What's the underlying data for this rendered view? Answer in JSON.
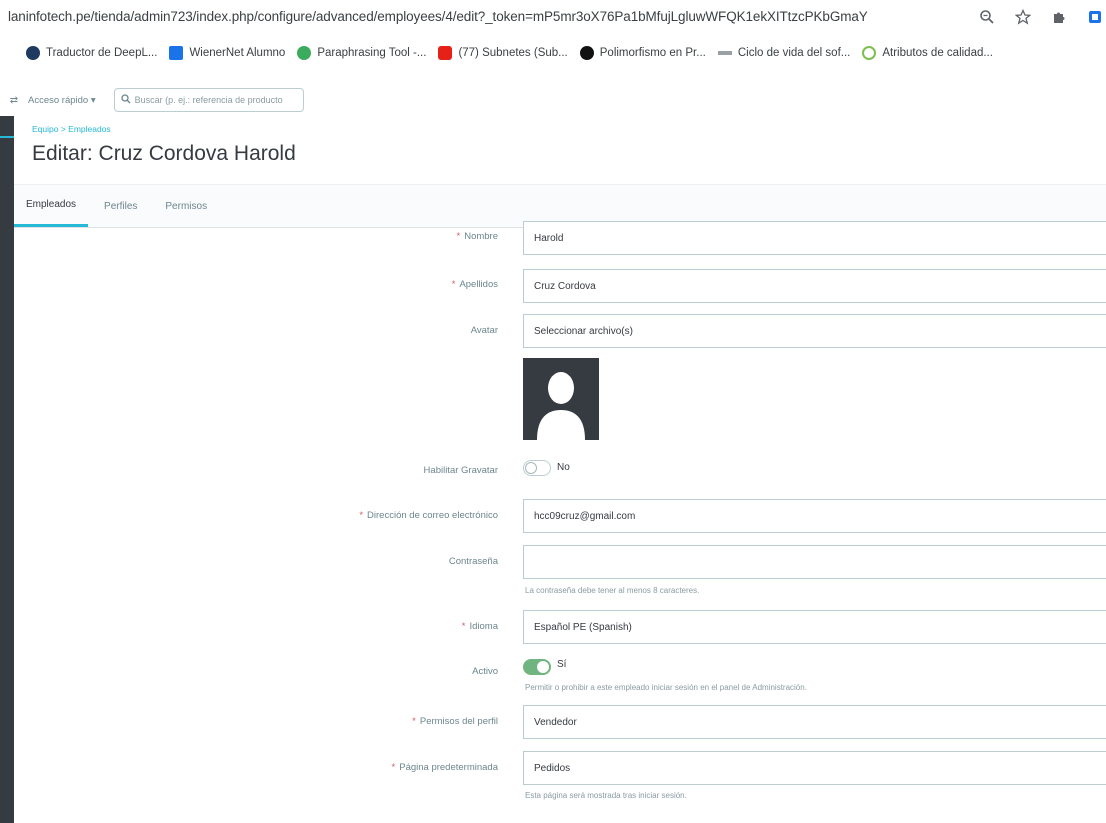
{
  "browser": {
    "url": "laninfotech.pe/tienda/admin723/index.php/configure/advanced/employees/4/edit?_token=mP5mr3oX76Pa1bMfujLgluwWFQK1ekXITtzcPKbGmaY",
    "icons": [
      "zoom-icon",
      "star-icon",
      "extensions-icon",
      "sidebar-icon"
    ]
  },
  "bookmarks": {
    "lead": "",
    "items": [
      {
        "label": "Traductor de DeepL...",
        "color": "#1e3a5f"
      },
      {
        "label": "WienerNet Alumno",
        "color": "#1a73e8"
      },
      {
        "label": "Paraphrasing Tool -...",
        "color": "#3bab5e"
      },
      {
        "label": "(77) Subnetes (Sub...",
        "color": "#e62117"
      },
      {
        "label": "Polimorfismo en Pr...",
        "color": "#111111"
      },
      {
        "label": "Ciclo de vida del sof...",
        "color": "#9aa0a6"
      },
      {
        "label": "Atributos de calidad...",
        "color": "#7cbf4e"
      }
    ]
  },
  "topbar": {
    "quick_access": "Acceso rápido ▾",
    "search_placeholder": "Buscar (p. ej.: referencia de producto"
  },
  "header": {
    "breadcrumb": "Equipo  >  Empleados",
    "title": "Editar: Cruz Cordova Harold"
  },
  "tabs": [
    {
      "label": "Empleados",
      "active": true
    },
    {
      "label": "Perfiles",
      "active": false
    },
    {
      "label": "Permisos",
      "active": false
    }
  ],
  "form": {
    "nombre": {
      "label": "Nombre",
      "value": "Harold"
    },
    "apellidos": {
      "label": "Apellidos",
      "value": "Cruz Cordova"
    },
    "avatar": {
      "label": "Avatar",
      "value": "Seleccionar archivo(s)"
    },
    "gravatar": {
      "label": "Habilitar Gravatar",
      "state": "No"
    },
    "email": {
      "label": "Dirección de correo electrónico",
      "value": "hcc09cruz@gmail.com"
    },
    "password": {
      "label": "Contraseña",
      "value": "",
      "help": "La contraseña debe tener al menos 8 caracteres."
    },
    "idioma": {
      "label": "Idioma",
      "value": "Español PE (Spanish)"
    },
    "activo": {
      "label": "Activo",
      "state": "Sí",
      "help": "Permitir o prohibir a este empleado iniciar sesión en el panel de Administración."
    },
    "perfil": {
      "label": "Permisos del perfil",
      "value": "Vendedor"
    },
    "pagina": {
      "label": "Página predeterminada",
      "value": "Pedidos",
      "help": "Esta página será mostrada tras iniciar sesión."
    }
  },
  "colors": {
    "accent": "#25b9d7",
    "switch_on": "#70b580",
    "sidebar": "#363a41"
  }
}
